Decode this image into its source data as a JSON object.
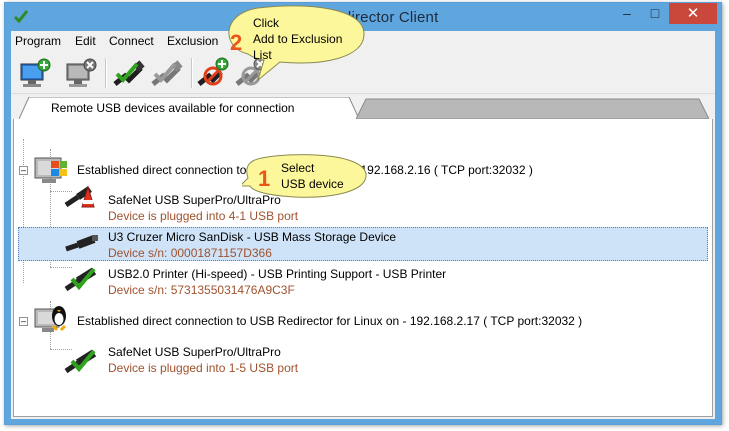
{
  "window": {
    "title": "USB Redirector Client",
    "controls": {
      "minimize": "–",
      "maximize": "□",
      "close": "✕"
    }
  },
  "menu": [
    "Program",
    "Edit",
    "Connect",
    "Exclusion"
  ],
  "tabs": {
    "active": "Remote USB devices available for connection"
  },
  "tree": {
    "servers": [
      {
        "label": "Established direct connection to USB Redirector on - 192.168.2.16 ( TCP port:32032 )",
        "icon": "windows-server-icon",
        "devices": [
          {
            "name": "SafeNet USB SuperPro/UltraPro",
            "info": "Device is plugged into 4-1 USB port",
            "icon": "usb-in-use-icon"
          },
          {
            "name": "U3 Cruzer Micro SanDisk - USB Mass Storage Device",
            "info": "Device s/n: 00001871157D366",
            "icon": "usb-plug-icon",
            "selected": true
          },
          {
            "name": "USB2.0 Printer (Hi-speed) - USB Printing Support - USB Printer",
            "info": "Device s/n: 5731355031476A9C3F",
            "icon": "usb-available-icon"
          }
        ]
      },
      {
        "label": "Established direct connection to USB Redirector for Linux on - 192.168.2.17 ( TCP port:32032 )",
        "icon": "linux-server-icon",
        "devices": [
          {
            "name": "SafeNet USB SuperPro/UltraPro",
            "info": "Device is plugged into 1-5 USB port",
            "icon": "usb-available-icon"
          }
        ]
      }
    ]
  },
  "callouts": [
    {
      "number": "2",
      "lines": [
        "Click",
        "Add to Exclusion",
        "List"
      ]
    },
    {
      "number": "1",
      "lines": [
        "Select",
        "USB device"
      ]
    }
  ],
  "colors": {
    "titlebar": "#5fa5de",
    "close": "#c9483b",
    "selection": "#cfe3f8",
    "device_info": "#a0522d",
    "callout_fill": "#fdf79b",
    "callout_number": "#e8561c"
  }
}
